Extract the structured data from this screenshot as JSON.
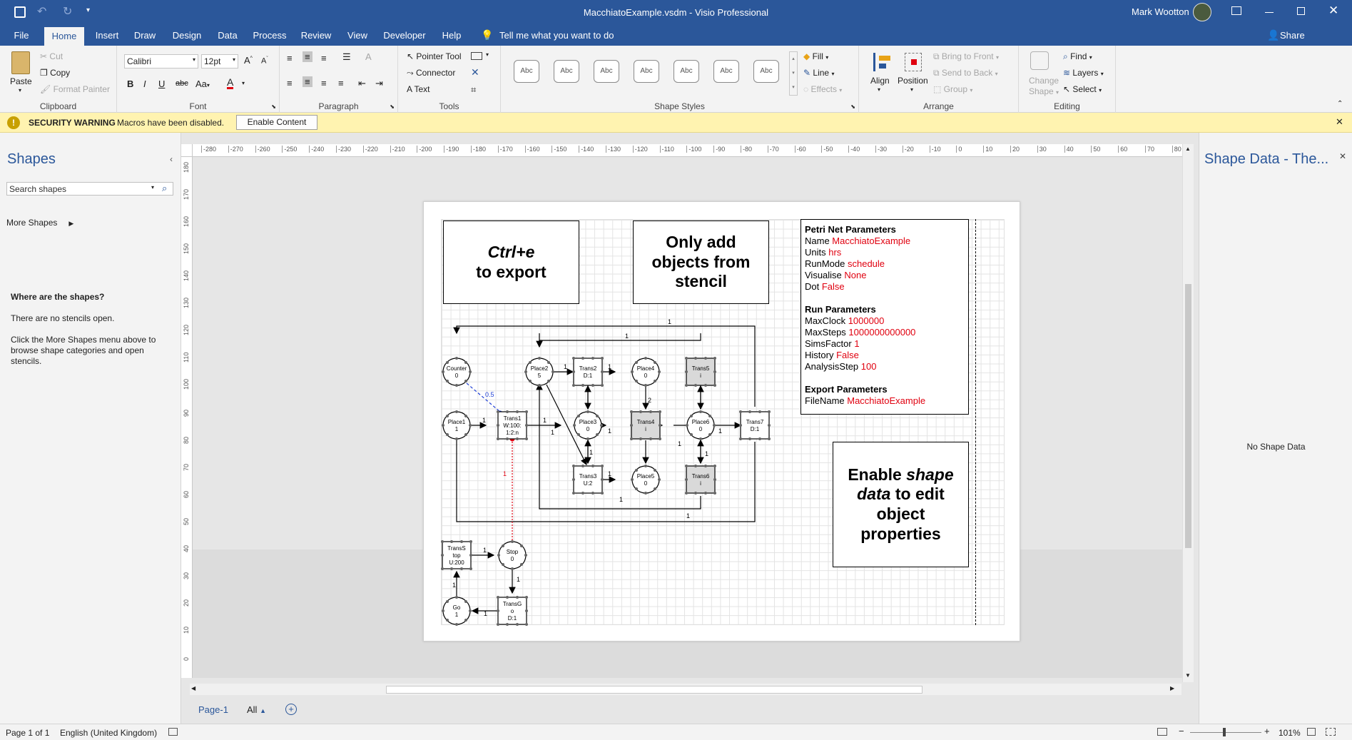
{
  "window": {
    "title": "MacchiatoExample.vsdm  -  Visio Professional",
    "user": "Mark Wootton"
  },
  "tabs": [
    "File",
    "Home",
    "Insert",
    "Draw",
    "Design",
    "Data",
    "Process",
    "Review",
    "View",
    "Developer",
    "Help"
  ],
  "tell_me": "Tell me what you want to do",
  "share": "Share",
  "ribbon": {
    "clipboard": {
      "label": "Clipboard",
      "paste": "Paste",
      "cut": "Cut",
      "copy": "Copy",
      "format_painter": "Format Painter"
    },
    "font": {
      "label": "Font",
      "family": "Calibri",
      "size": "12pt"
    },
    "paragraph": {
      "label": "Paragraph"
    },
    "tools": {
      "label": "Tools",
      "pointer": "Pointer Tool",
      "connector": "Connector",
      "text": "Text"
    },
    "shape_styles": {
      "label": "Shape Styles",
      "swatch": "Abc",
      "fill": "Fill",
      "line": "Line",
      "effects": "Effects"
    },
    "arrange": {
      "label": "Arrange",
      "align": "Align",
      "position": "Position",
      "bring_front": "Bring to Front",
      "send_back": "Send to Back",
      "group": "Group"
    },
    "editing": {
      "label": "Editing",
      "change_shape_1": "Change",
      "change_shape_2": "Shape",
      "find": "Find",
      "layers": "Layers",
      "select": "Select"
    }
  },
  "security": {
    "title": "SECURITY WARNING",
    "message": "Macros have been disabled.",
    "button": "Enable Content"
  },
  "shapes_panel": {
    "title": "Shapes",
    "search_placeholder": "Search shapes",
    "more_shapes": "More Shapes",
    "where_title": "Where are the shapes?",
    "no_stencils": "There are no stencils open.",
    "hint": "Click the More Shapes menu above to browse shape categories and open stencils."
  },
  "shape_data_panel": {
    "title": "Shape Data - The...",
    "empty": "No Shape Data"
  },
  "ruler": {
    "h": [
      "-280",
      "-270",
      "-260",
      "-250",
      "-240",
      "-230",
      "-220",
      "-210",
      "-200",
      "-190",
      "-180",
      "-170",
      "-160",
      "-150",
      "-140",
      "-130",
      "-120",
      "-110",
      "-100",
      "-90",
      "-80",
      "-70",
      "-60",
      "-50",
      "-40",
      "-30",
      "-20",
      "-10",
      "0",
      "10",
      "20",
      "30",
      "40",
      "50",
      "60",
      "70",
      "80"
    ],
    "v": [
      "180",
      "170",
      "160",
      "150",
      "140",
      "130",
      "120",
      "110",
      "100",
      "90",
      "80",
      "70",
      "60",
      "50",
      "40",
      "30",
      "20",
      "10",
      "0"
    ]
  },
  "notes": {
    "export_1": "Ctrl+e",
    "export_2": "to export",
    "stencil": "Only add objects from stencil",
    "enable_1": "Enable ",
    "enable_2": "shape data",
    "enable_3": " to edit object properties"
  },
  "params": {
    "petri_title": "Petri Net Parameters",
    "name_k": "Name ",
    "name_v": "MacchiatoExample",
    "units_k": "Units ",
    "units_v": "hrs",
    "runmode_k": "RunMode ",
    "runmode_v": "schedule",
    "visualise_k": "Visualise ",
    "visualise_v": "None",
    "dot_k": "Dot ",
    "dot_v": "False",
    "run_title": "Run Parameters",
    "maxclock_k": "MaxClock ",
    "maxclock_v": "1000000",
    "maxsteps_k": "MaxSteps ",
    "maxsteps_v": "1000000000000",
    "sims_k": "SimsFactor ",
    "sims_v": "1",
    "history_k": "History ",
    "history_v": "False",
    "analysis_k": "AnalysisStep ",
    "analysis_v": "100",
    "export_title": "Export Parameters",
    "filename_k": "FileName ",
    "filename_v": "MacchiatoExample"
  },
  "petri": {
    "places": [
      {
        "id": "Counter",
        "l1": "Counter",
        "l2": "0"
      },
      {
        "id": "Place2",
        "l1": "Place2",
        "l2": "5"
      },
      {
        "id": "Place4",
        "l1": "Place4",
        "l2": "0"
      },
      {
        "id": "Place1",
        "l1": "Place1",
        "l2": "1"
      },
      {
        "id": "Place3",
        "l1": "Place3",
        "l2": "0"
      },
      {
        "id": "Place6",
        "l1": "Place6",
        "l2": "0"
      },
      {
        "id": "Place5",
        "l1": "Place5",
        "l2": "0"
      },
      {
        "id": "Stop",
        "l1": "Stop",
        "l2": "0"
      },
      {
        "id": "Go",
        "l1": "Go",
        "l2": "1"
      }
    ],
    "transitions": [
      {
        "id": "Trans2",
        "lines": [
          "Trans2",
          "D:1"
        ]
      },
      {
        "id": "Trans5",
        "lines": [
          "Trans5",
          "i"
        ]
      },
      {
        "id": "Trans1",
        "lines": [
          "Trans1",
          "W:100:",
          "1:2:n"
        ]
      },
      {
        "id": "Trans4",
        "lines": [
          "Trans4",
          "i"
        ]
      },
      {
        "id": "Trans7",
        "lines": [
          "Trans7",
          "D:1"
        ]
      },
      {
        "id": "Trans3",
        "lines": [
          "Trans3",
          "U:2"
        ]
      },
      {
        "id": "Trans6",
        "lines": [
          "Trans6",
          "i"
        ]
      },
      {
        "id": "TransStop",
        "lines": [
          "TransS",
          "top",
          "U:200"
        ]
      },
      {
        "id": "TransGo",
        "lines": [
          "TransG",
          "o",
          "D:1"
        ]
      }
    ],
    "weights": {
      "w1": "1",
      "w05": "0.5",
      "w2": "2"
    }
  },
  "status": {
    "page": "Page 1 of 1",
    "lang": "English (United Kingdom)",
    "zoom": "101%"
  },
  "pagetabs": {
    "page1": "Page-1",
    "all": "All"
  }
}
